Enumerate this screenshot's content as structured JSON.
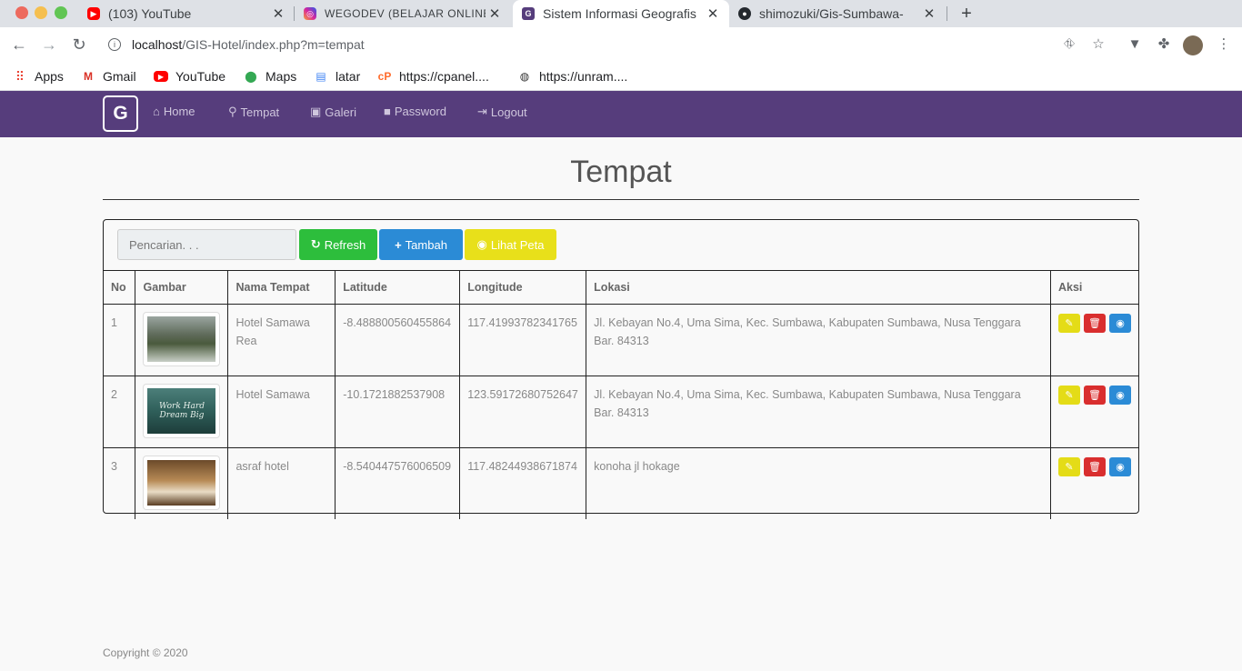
{
  "browser": {
    "tabs": [
      {
        "title": "(103) YouTube",
        "icon": "youtube-icon"
      },
      {
        "title": "WEGODEV (BELAJAR ONLINE",
        "icon": "instagram-icon"
      },
      {
        "title": "Sistem Informasi Geografis",
        "icon": "site-g-icon"
      },
      {
        "title": "shimozuki/Gis-Sumbawa-",
        "icon": "github-icon"
      }
    ],
    "new_tab": "+",
    "url_host": "localhost",
    "url_path": "/GIS-Hotel/index.php?m=tempat",
    "bookmarks": [
      {
        "label": "Apps",
        "icon": "apps-grid-icon"
      },
      {
        "label": "Gmail",
        "icon": "gmail-icon"
      },
      {
        "label": "YouTube",
        "icon": "youtube-icon"
      },
      {
        "label": "Maps",
        "icon": "maps-pin-icon"
      },
      {
        "label": "latar",
        "icon": "document-icon"
      },
      {
        "label": "https://cpanel....",
        "icon": "cpanel-icon"
      },
      {
        "label": "https://unram....",
        "icon": "globe-icon"
      }
    ]
  },
  "navbar": {
    "brand": "G",
    "items": [
      {
        "label": "Home",
        "icon": "home-icon"
      },
      {
        "label": "Tempat",
        "icon": "map-marker-icon"
      },
      {
        "label": "Galeri",
        "icon": "picture-icon"
      },
      {
        "label": "Password",
        "icon": "lock-icon"
      },
      {
        "label": "Logout",
        "icon": "logout-icon"
      }
    ]
  },
  "page": {
    "title": "Tempat",
    "search_placeholder": "Pencarian. . .",
    "buttons": {
      "refresh": "Refresh",
      "tambah": "Tambah",
      "lihat_peta": "Lihat Peta"
    },
    "columns": [
      "No",
      "Gambar",
      "Nama Tempat",
      "Latitude",
      "Longitude",
      "Lokasi",
      "Aksi"
    ],
    "rows": [
      {
        "no": "1",
        "nama": "Hotel Samawa Rea",
        "lat": "-8.488800560455864",
        "lng": "117.41993782341765",
        "lokasi": "Jl. Kebayan No.4, Uma Sima, Kec. Sumbawa, Kabupaten Sumbawa, Nusa Tenggara Bar. 84313",
        "thumb_text": ""
      },
      {
        "no": "2",
        "nama": "Hotel Samawa",
        "lat": "-10.1721882537908",
        "lng": "123.59172680752647",
        "lokasi": "Jl. Kebayan No.4, Uma Sima, Kec. Sumbawa, Kabupaten Sumbawa, Nusa Tenggara Bar. 84313",
        "thumb_text": "Work Hard Dream Big"
      },
      {
        "no": "3",
        "nama": "asraf hotel",
        "lat": "-8.540447576006509",
        "lng": "117.48244938671874",
        "lokasi": "konoha jl hokage",
        "thumb_text": ""
      }
    ],
    "footer": "Copyright © 2020"
  },
  "colors": {
    "navbar": "#563d7c",
    "refresh": "#2dbe3c",
    "tambah": "#2b8bd6",
    "lihat_peta": "#e8e01a",
    "edit": "#e4dc17",
    "delete": "#d92e2e",
    "view": "#2b8bd6"
  }
}
